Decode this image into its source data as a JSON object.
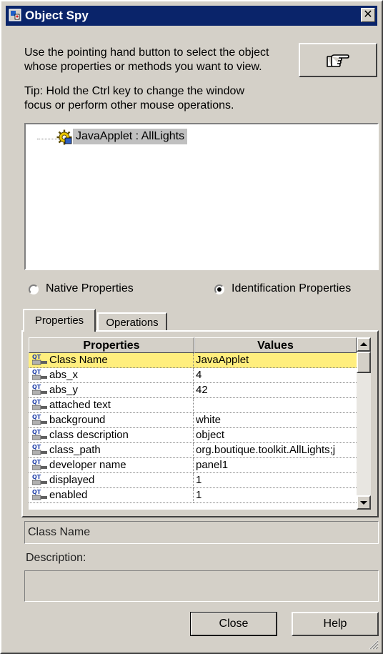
{
  "window": {
    "title": "Object Spy",
    "close_glyph": "✕"
  },
  "instructions": {
    "line1": "Use the pointing hand button to select the object",
    "line2": "whose properties or methods you want to view.",
    "tip1": "Tip: Hold the Ctrl key to change the window",
    "tip2": "focus or perform other mouse operations.",
    "hand_icon": "pointing-hand-icon"
  },
  "tree": {
    "node_label": "JavaApplet : AllLights",
    "node_icon": "applet-gear-icon"
  },
  "radios": {
    "native_label": "Native Properties",
    "identification_label": "Identification Properties",
    "selected": "identification"
  },
  "tabs": {
    "properties": "Properties",
    "operations": "Operations",
    "active": "properties"
  },
  "grid": {
    "col_properties": "Properties",
    "col_values": "Values",
    "rows": [
      {
        "property": "Class Name",
        "value": "JavaApplet"
      },
      {
        "property": "abs_x",
        "value": "4"
      },
      {
        "property": "abs_y",
        "value": "42"
      },
      {
        "property": "attached text",
        "value": ""
      },
      {
        "property": "background",
        "value": "white"
      },
      {
        "property": "class description",
        "value": "object"
      },
      {
        "property": "class_path",
        "value": "org.boutique.toolkit.AllLights;j"
      },
      {
        "property": "developer name",
        "value": "panel1"
      },
      {
        "property": "displayed",
        "value": "1"
      },
      {
        "property": "enabled",
        "value": "1"
      }
    ],
    "selected_row": 0,
    "selected_color": "#ffee7e"
  },
  "status": {
    "selected_property": "Class Name",
    "description_label": "Description:",
    "description_value": ""
  },
  "buttons": {
    "close": "Close",
    "help": "Help"
  },
  "colors": {
    "titlebar": "#0a246a",
    "face": "#d4d0c8",
    "tree_selection": "#c0c0c0"
  }
}
